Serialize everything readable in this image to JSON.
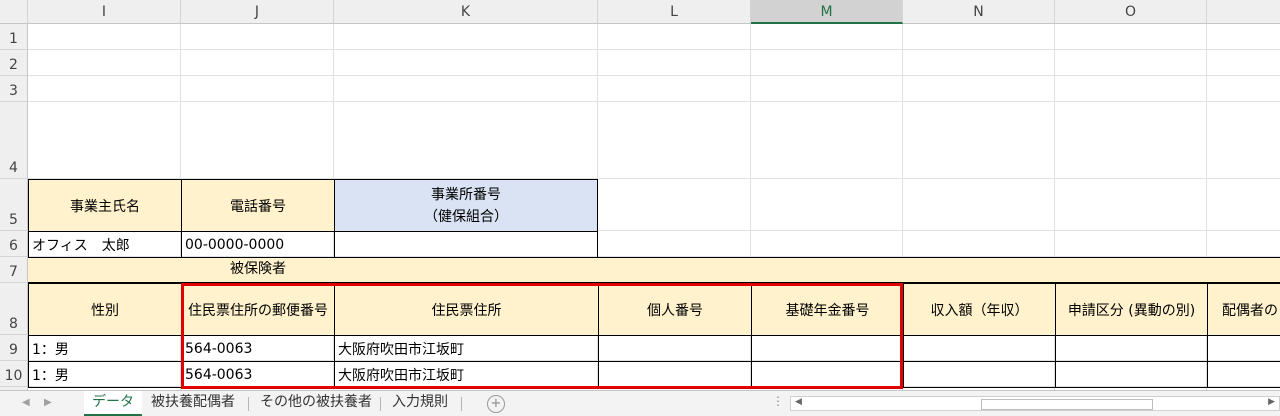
{
  "columns": [
    "I",
    "J",
    "K",
    "L",
    "M",
    "N",
    "O"
  ],
  "selected_column": "M",
  "rows": [
    "1",
    "2",
    "3",
    "4",
    "5",
    "6",
    "7",
    "8",
    "9",
    "10"
  ],
  "header_row5": {
    "owner_name": "事業主氏名",
    "phone": "電話番号",
    "office_number_line1": "事業所番号",
    "office_number_line2": "（健保組合）"
  },
  "row6": {
    "owner_name": "オフィス　太郎",
    "phone": "00-0000-0000",
    "office_number": ""
  },
  "row7": {
    "insured": "被保険者"
  },
  "header_row8": {
    "gender": "性別",
    "postal": "住民票住所の郵便番号",
    "address": "住民票住所",
    "personal_number": "個人番号",
    "pension_number": "基礎年金番号",
    "income": "収入額（年収）",
    "application": "申請区分 (異動の別)",
    "spouse": "配偶者の"
  },
  "data_rows": [
    {
      "gender": "1：男",
      "postal": "564-0063",
      "address": "大阪府吹田市江坂町"
    },
    {
      "gender": "1：男",
      "postal": "564-0063",
      "address": "大阪府吹田市江坂町"
    }
  ],
  "sheet_tabs": [
    "データ",
    "被扶養配偶者",
    "その他の被扶養者",
    "入力規則"
  ],
  "active_tab": "データ",
  "colors": {
    "header_fill": "#fff2cc",
    "blue_fill": "#dae3f3",
    "highlight": "#e00000",
    "excel_green": "#217346"
  }
}
